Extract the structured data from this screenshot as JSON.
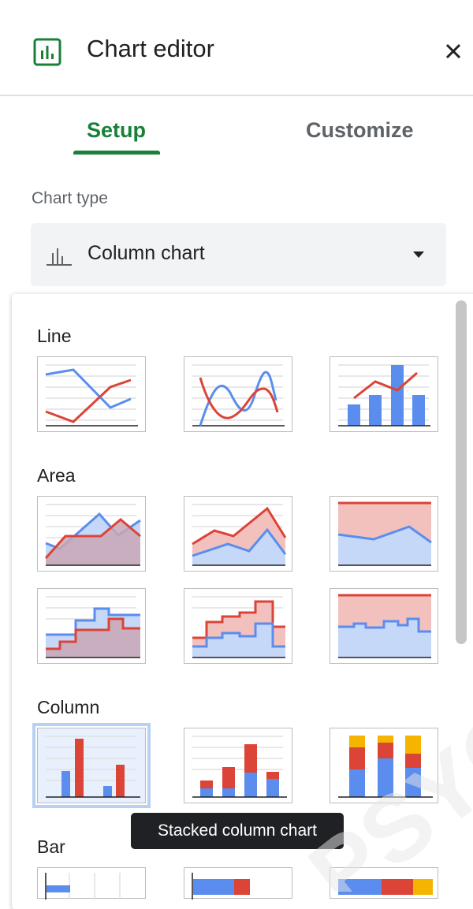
{
  "header": {
    "title": "Chart editor"
  },
  "tabs": {
    "setup": "Setup",
    "customize": "Customize"
  },
  "chart_type": {
    "label": "Chart type",
    "selected": "Column chart"
  },
  "sections": {
    "line": "Line",
    "area": "Area",
    "column": "Column",
    "bar": "Bar"
  },
  "tooltip": {
    "text": "Stacked column chart"
  },
  "watermark": {
    "text": "PSYCH"
  },
  "colors": {
    "accent": "#188038",
    "blue": "#5b8def",
    "red": "#db4437",
    "yellow": "#f4b400",
    "fill_blue": "#c6d8f8",
    "fill_red": "#f3c1bd"
  }
}
